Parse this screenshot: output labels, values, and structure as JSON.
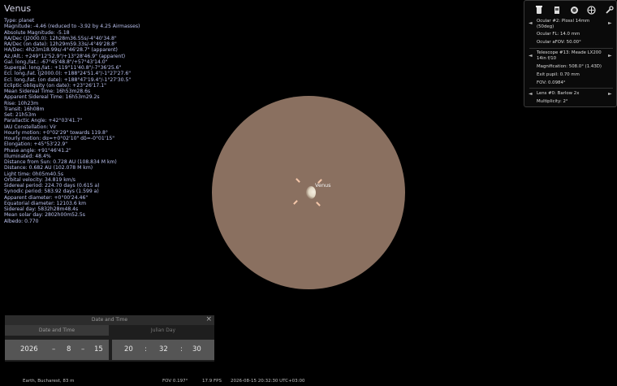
{
  "object": {
    "name": "Venus",
    "lines": [
      "Type: planet",
      "Magnitude: -4.46 (reduced to -3.92 by 4.25 Airmasses)",
      "Absolute Magnitude: -5.18",
      "RA/Dec (J2000.0): 12h28m36.55s/-4°40'34.8\"",
      "RA/Dec (on date): 12h29m59.33s/-4°49'28.8\"",
      "HA/Dec: 4h23m18.99s/-4°46'28.7\" (apparent)",
      "Az./Alt.: +249°12'52.9\"/+13°28'46.9\" (apparent)",
      "Gal. long./lat.: -67°45'48.8\"/+57°43'14.0\"",
      "Supergal. long./lat.: +119°11'40.8\"/-7°36'25.6\"",
      "Ecl. long./lat. (J2000.0): +188°24'51.4\"/-1°27'27.6\"",
      "Ecl. long./lat. (on date): +188°47'19.4\"/-1°27'30.5\"",
      "Ecliptic obliquity (on date): +23°26'17.1\"",
      "Mean Sidereal Time: 16h53m28.6s",
      "Apparent Sidereal Time: 16h53m29.2s",
      "Rise: 10h23m",
      "Transit: 16h08m",
      "Set: 21h53m",
      "Parallactic Angle: +42°03'41.7\"",
      "IAU Constellation: Vir",
      "Hourly motion: +0°02'29\" towards 119.8°",
      "Hourly motion: dα=+0°02'10\" dδ=-0°01'15\"",
      "Elongation: +45°53'22.9\"",
      "Phase angle: +91°46'41.2\"",
      "Illuminated: 48.4%",
      "Distance from Sun: 0.728 AU (108.834 M km)",
      "Distance: 0.682 AU (102.078 M km)",
      "Light time: 0h05m40.5s",
      "Orbital velocity: 34.819 km/s",
      "Sidereal period: 224.70 days (0.615 a)",
      "Synodic period: 583.92 days (1.599 a)",
      "Apparent diameter: +0°00'24.46\"",
      "Equatorial diameter: 12103.6 km",
      "Sidereal day: 5832h28m48.4s",
      "Mean solar day: 2802h00m52.5s",
      "Albedo: 0.770"
    ]
  },
  "sky": {
    "label": "Venus"
  },
  "oculars": {
    "icons": [
      "ocular-icon",
      "ccd-icon",
      "telrad-icon",
      "flip-icon",
      "configure-icon"
    ],
    "prev_arrow": "◄",
    "next_arrow": "►",
    "ocular_name": "Ocular #2: Plossl 14mm",
    "ocular_name_2": "(50deg)",
    "ocular_fl": "Ocular FL: 14.0 mm",
    "ocular_afov": "Ocular aFOV: 50.00°",
    "telescope_name": "Telescope #13: Meade  LX200",
    "telescope_name_2": "14in f/10",
    "magnification": "Magnification: 508.0° (1.43D)",
    "exit_pupil": "Exit pupil: 0.70 mm",
    "fov": "FOV: 0.0984°",
    "lens_name": "Lens #0: Barlow 2x",
    "multiplicity": "Multiplicity: 2°"
  },
  "date_dialog": {
    "title": "Date and Time",
    "close": "×",
    "tabs": [
      "Date and Time",
      "Julian Day"
    ],
    "year": "2026",
    "month": "8",
    "day": "15",
    "hour": "20",
    "minute": "32",
    "second": "30",
    "date_sep": "–",
    "time_sep": ":"
  },
  "status": {
    "location": "Earth, Bucharest, 83 m",
    "fov": "FOV 0.197°",
    "fps": "17.9 FPS",
    "datetime": "2026-08-15 20:32:30 UTC+03:00"
  },
  "colors": {
    "info_text": "#bcc3f0",
    "eyepiece_field": "#8a7060",
    "marker": "#f4c6a9"
  }
}
